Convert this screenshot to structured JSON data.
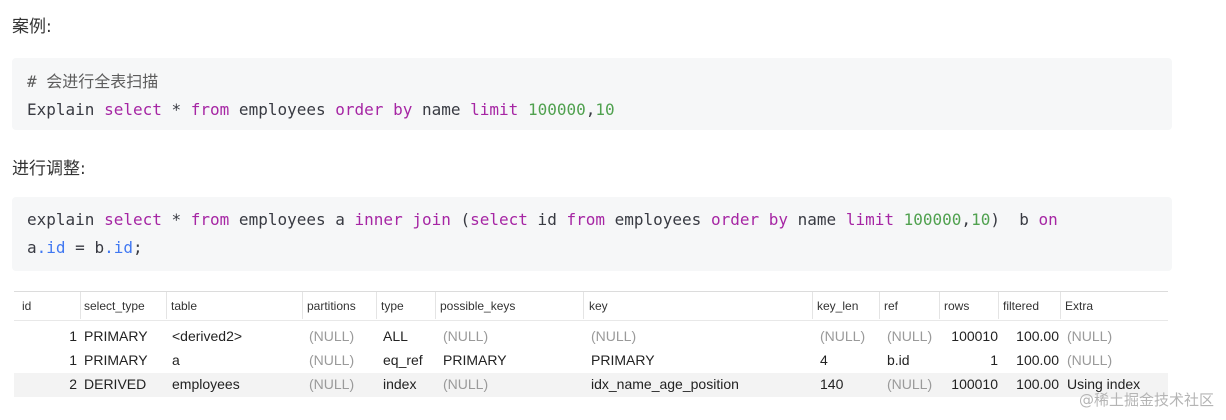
{
  "section1": {
    "heading": "案例:",
    "code": {
      "comment": "# 会进行全表扫描",
      "tokens": [
        "Explain ",
        "select",
        " * ",
        "from",
        " employees ",
        "order by",
        " name ",
        "limit",
        " ",
        "100000",
        ",",
        "10"
      ]
    }
  },
  "section2": {
    "heading": "进行调整:",
    "code": {
      "line1": [
        "explain ",
        "select",
        " * ",
        "from",
        " employees a ",
        "inner join",
        " (",
        "select",
        " id ",
        "from",
        " employees ",
        "order by",
        " name ",
        "limit",
        " ",
        "100000",
        ",",
        "10",
        ")  b ",
        "on"
      ],
      "line2": [
        "a",
        ".id",
        " = b",
        ".id",
        ";"
      ]
    }
  },
  "result": {
    "columns": [
      "id",
      "select_type",
      "table",
      "partitions",
      "type",
      "possible_keys",
      "key",
      "key_len",
      "ref",
      "rows",
      "filtered",
      "Extra"
    ],
    "rows": [
      [
        "1",
        "PRIMARY",
        "<derived2>",
        "(NULL)",
        "ALL",
        "(NULL)",
        "(NULL)",
        "(NULL)",
        "(NULL)",
        "100010",
        "100.00",
        "(NULL)"
      ],
      [
        "1",
        "PRIMARY",
        "a",
        "(NULL)",
        "eq_ref",
        "PRIMARY",
        "PRIMARY",
        "4",
        "b.id",
        "1",
        "100.00",
        "(NULL)"
      ],
      [
        "2",
        "DERIVED",
        "employees",
        "(NULL)",
        "index",
        "(NULL)",
        "idx_name_age_position",
        "140",
        "(NULL)",
        "100010",
        "100.00",
        "Using index"
      ]
    ]
  },
  "watermark": "@稀土掘金技术社区",
  "colors": {
    "keyword": "#a626a4",
    "number": "#50a14f",
    "property": "#4078f2",
    "code_bg": "#f6f7f8",
    "null_text": "#9a9a9a"
  }
}
